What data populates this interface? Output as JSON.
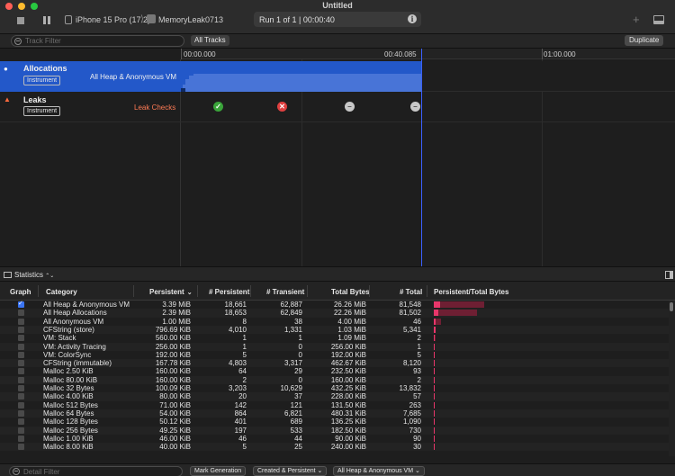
{
  "window": {
    "title": "Untitled"
  },
  "toolbar": {
    "device": "iPhone 15 Pro (17.2)",
    "separator": "⟩",
    "process": "MemoryLeak0713",
    "run_status": "Run 1 of 1  |  00:00:40",
    "info_glyph": "i",
    "add_glyph": "+"
  },
  "filterbar": {
    "track_filter_placeholder": "Track Filter",
    "all_tracks_label": "All Tracks",
    "duplicate_label": "Duplicate"
  },
  "timeline": {
    "ticks": [
      "00:00.000",
      "00:40.085",
      "01:00.000"
    ],
    "tracks": [
      {
        "name": "Allocations",
        "badge": "Instrument",
        "detail": "All Heap & Anonymous VM",
        "icon_color": "#ffffff"
      },
      {
        "name": "Leaks",
        "badge": "Instrument",
        "detail": "Leak Checks",
        "icon_color": "#ff6a3d"
      }
    ],
    "leak_checks": [
      {
        "status": "ok",
        "glyph": "✓"
      },
      {
        "status": "leak",
        "glyph": "✕"
      },
      {
        "status": "none",
        "glyph": "–"
      },
      {
        "status": "none",
        "glyph": "–"
      }
    ]
  },
  "statistics": {
    "label": "Statistics",
    "chevron": "⌃⌄"
  },
  "table": {
    "columns": {
      "graph": "Graph",
      "category": "Category",
      "persistent": "Persistent",
      "num_persistent": "# Persistent",
      "num_transient": "# Transient",
      "total_bytes": "Total Bytes",
      "num_total": "# Total",
      "ratio": "Persistent/Total Bytes"
    },
    "sort_glyph": "⌄",
    "rows": [
      {
        "checked": true,
        "category": "All Heap & Anonymous VM",
        "persistent": "3.39 MiB",
        "num_persistent": "18,661",
        "num_transient": "62,887",
        "total_bytes": "26.26 MiB",
        "num_total": "81,548",
        "bar_total": 1.0,
        "bar_persistent": 0.13
      },
      {
        "checked": false,
        "category": "All Heap Allocations",
        "persistent": "2.39 MiB",
        "num_persistent": "18,653",
        "num_transient": "62,849",
        "total_bytes": "22.26 MiB",
        "num_total": "81,502",
        "bar_total": 0.85,
        "bar_persistent": 0.09
      },
      {
        "checked": false,
        "category": "All Anonymous VM",
        "persistent": "1.00 MiB",
        "num_persistent": "8",
        "num_transient": "38",
        "total_bytes": "4.00 MiB",
        "num_total": "46",
        "bar_total": 0.15,
        "bar_persistent": 0.04
      },
      {
        "checked": false,
        "category": "CFString (store)",
        "persistent": "796.69 KiB",
        "num_persistent": "4,010",
        "num_transient": "1,331",
        "total_bytes": "1.03 MiB",
        "num_total": "5,341",
        "bar_total": 0.04,
        "bar_persistent": 0.03
      },
      {
        "checked": false,
        "category": "VM: Stack",
        "persistent": "560.00 KiB",
        "num_persistent": "1",
        "num_transient": "1",
        "total_bytes": "1.09 MiB",
        "num_total": "2",
        "bar_total": 0.04,
        "bar_persistent": 0.02
      },
      {
        "checked": false,
        "category": "VM: Activity Tracing",
        "persistent": "256.00 KiB",
        "num_persistent": "1",
        "num_transient": "0",
        "total_bytes": "256.00 KiB",
        "num_total": "1",
        "bar_total": 0.01,
        "bar_persistent": 0.01
      },
      {
        "checked": false,
        "category": "VM: ColorSync",
        "persistent": "192.00 KiB",
        "num_persistent": "5",
        "num_transient": "0",
        "total_bytes": "192.00 KiB",
        "num_total": "5",
        "bar_total": 0.007,
        "bar_persistent": 0.007
      },
      {
        "checked": false,
        "category": "CFString (immutable)",
        "persistent": "167.78 KiB",
        "num_persistent": "4,803",
        "num_transient": "3,317",
        "total_bytes": "462.67 KiB",
        "num_total": "8,120",
        "bar_total": 0.017,
        "bar_persistent": 0.006
      },
      {
        "checked": false,
        "category": "Malloc 2.50 KiB",
        "persistent": "160.00 KiB",
        "num_persistent": "64",
        "num_transient": "29",
        "total_bytes": "232.50 KiB",
        "num_total": "93",
        "bar_total": 0.009,
        "bar_persistent": 0.006
      },
      {
        "checked": false,
        "category": "Malloc 80.00 KiB",
        "persistent": "160.00 KiB",
        "num_persistent": "2",
        "num_transient": "0",
        "total_bytes": "160.00 KiB",
        "num_total": "2",
        "bar_total": 0.006,
        "bar_persistent": 0.006
      },
      {
        "checked": false,
        "category": "Malloc 32 Bytes",
        "persistent": "100.09 KiB",
        "num_persistent": "3,203",
        "num_transient": "10,629",
        "total_bytes": "432.25 KiB",
        "num_total": "13,832",
        "bar_total": 0.016,
        "bar_persistent": 0.004
      },
      {
        "checked": false,
        "category": "Malloc 4.00 KiB",
        "persistent": "80.00 KiB",
        "num_persistent": "20",
        "num_transient": "37",
        "total_bytes": "228.00 KiB",
        "num_total": "57",
        "bar_total": 0.008,
        "bar_persistent": 0.003
      },
      {
        "checked": false,
        "category": "Malloc 512 Bytes",
        "persistent": "71.00 KiB",
        "num_persistent": "142",
        "num_transient": "121",
        "total_bytes": "131.50 KiB",
        "num_total": "263",
        "bar_total": 0.005,
        "bar_persistent": 0.003
      },
      {
        "checked": false,
        "category": "Malloc 64 Bytes",
        "persistent": "54.00 KiB",
        "num_persistent": "864",
        "num_transient": "6,821",
        "total_bytes": "480.31 KiB",
        "num_total": "7,685",
        "bar_total": 0.018,
        "bar_persistent": 0.002
      },
      {
        "checked": false,
        "category": "Malloc 128 Bytes",
        "persistent": "50.12 KiB",
        "num_persistent": "401",
        "num_transient": "689",
        "total_bytes": "136.25 KiB",
        "num_total": "1,090",
        "bar_total": 0.005,
        "bar_persistent": 0.002
      },
      {
        "checked": false,
        "category": "Malloc 256 Bytes",
        "persistent": "49.25 KiB",
        "num_persistent": "197",
        "num_transient": "533",
        "total_bytes": "182.50 KiB",
        "num_total": "730",
        "bar_total": 0.007,
        "bar_persistent": 0.002
      },
      {
        "checked": false,
        "category": "Malloc 1.00 KiB",
        "persistent": "46.00 KiB",
        "num_persistent": "46",
        "num_transient": "44",
        "total_bytes": "90.00 KiB",
        "num_total": "90",
        "bar_total": 0.003,
        "bar_persistent": 0.002
      },
      {
        "checked": false,
        "category": "Malloc 8.00 KiB",
        "persistent": "40.00 KiB",
        "num_persistent": "5",
        "num_transient": "25",
        "total_bytes": "240.00 KiB",
        "num_total": "30",
        "bar_total": 0.009,
        "bar_persistent": 0.001
      }
    ]
  },
  "bottombar": {
    "detail_filter_placeholder": "Detail Filter",
    "mark_generation": "Mark Generation",
    "lifespan_filter": "Created & Persistent ⌄",
    "allocation_type_filter": "All Heap & Anonymous VM ⌄"
  },
  "colors": {
    "accent": "#2358c9",
    "playhead": "#3b60ff",
    "bar_persistent": "#e8366a",
    "bar_total": "#6e1f33",
    "leak_ok": "#3aa43a",
    "leak_found": "#e04040"
  }
}
